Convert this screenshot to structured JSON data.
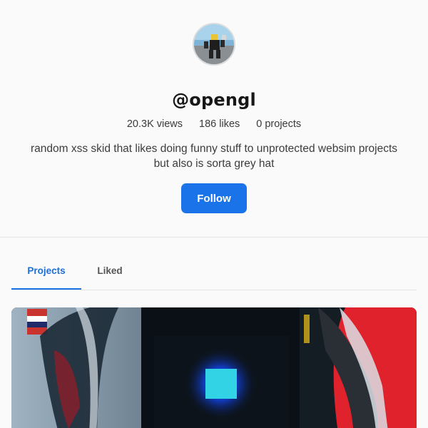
{
  "profile": {
    "username": "@opengl",
    "stats": {
      "views": "20.3K views",
      "likes": "186 likes",
      "projects": "0 projects"
    },
    "bio_line1": "random xss skid that likes doing funny stuff to unprotected websim projects",
    "bio_line2": "but also is sorta grey hat",
    "follow_label": "Follow"
  },
  "tabs": {
    "projects": "Projects",
    "liked": "Liked"
  },
  "colors": {
    "accent": "#1a73e8",
    "background": "#fafafa"
  }
}
